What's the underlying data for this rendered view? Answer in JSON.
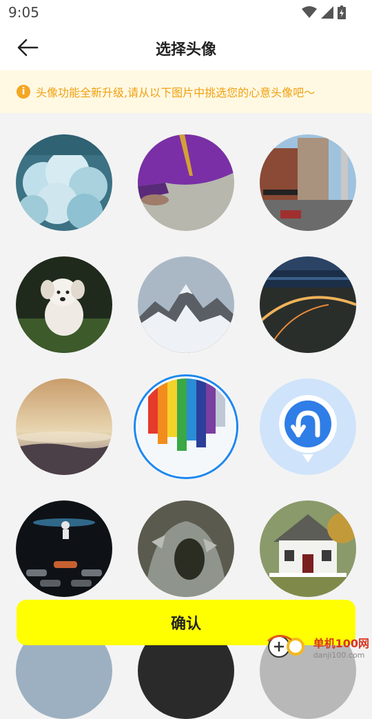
{
  "status_bar": {
    "time": "9:05"
  },
  "header": {
    "title": "选择头像",
    "back_icon": "arrow-left-icon"
  },
  "notice": {
    "icon": "info-icon",
    "text": "头像功能全新升级,请从以下图片中挑选您的心意头像吧～"
  },
  "avatars": [
    {
      "subject": "clouds"
    },
    {
      "subject": "purple-fabric"
    },
    {
      "subject": "city-street"
    },
    {
      "subject": "running-dog"
    },
    {
      "subject": "snowy-mountains"
    },
    {
      "subject": "night-bridge"
    },
    {
      "subject": "foggy-sunrise"
    },
    {
      "subject": "rainbow-paint",
      "selected": true
    },
    {
      "subject": "u-turn-app-icon"
    },
    {
      "subject": "astronaut-cars"
    },
    {
      "subject": "rock-tree"
    },
    {
      "subject": "white-house"
    },
    {
      "subject": "sky-partial"
    },
    {
      "subject": "haus-shirt-partial"
    },
    {
      "subject": "gray-partial"
    }
  ],
  "confirm_label": "确认",
  "watermark": {
    "line1": "单机100网",
    "line2": "danji100.com"
  }
}
